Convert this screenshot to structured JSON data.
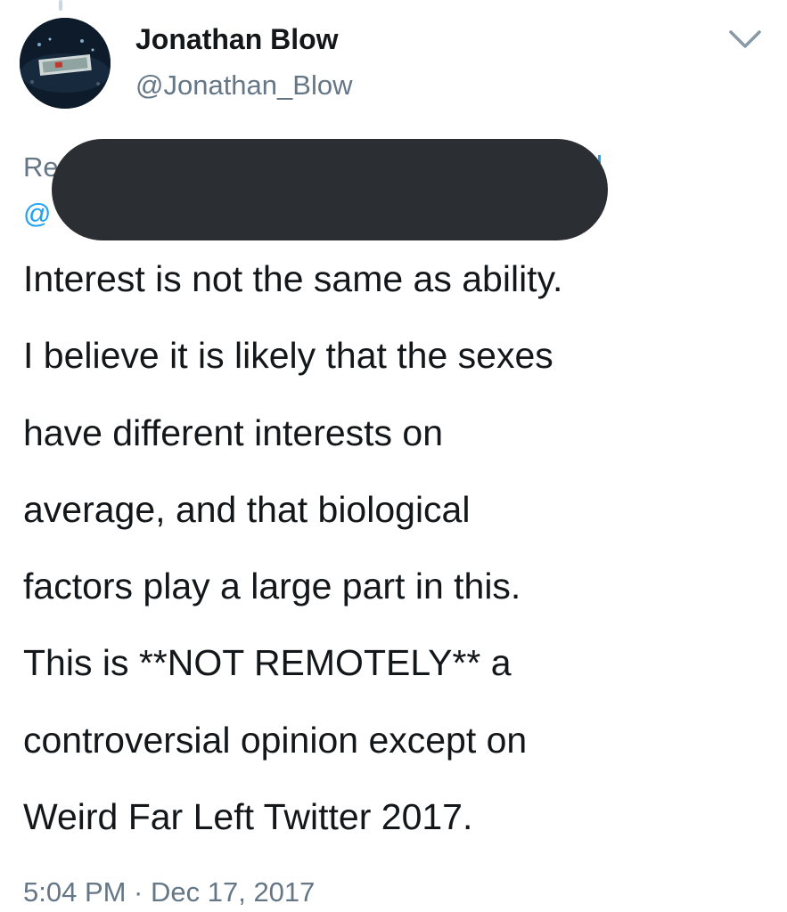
{
  "author": {
    "display_name": "Jonathan Blow",
    "handle": "@Jonathan_Blow",
    "avatar_icon": "avatar-photo"
  },
  "reply_context": {
    "line1_visible": "Re",
    "line2_visible": "@"
  },
  "tweet": {
    "lines": [
      "Interest is not the same as ability.",
      "I believe it is likely that the sexes",
      "have different interests on",
      "average, and that biological",
      "factors play a large part in this.",
      "This is **NOT REMOTELY** a",
      "controversial opinion except on",
      "Weird Far Left Twitter 2017."
    ],
    "timestamp": "5:04 PM · Dec 17, 2017"
  },
  "menu_icon": "chevron-down-icon",
  "colors": {
    "text": "#14171a",
    "secondary": "#657786",
    "link": "#1da1f2",
    "redaction": "#2b2e33"
  }
}
